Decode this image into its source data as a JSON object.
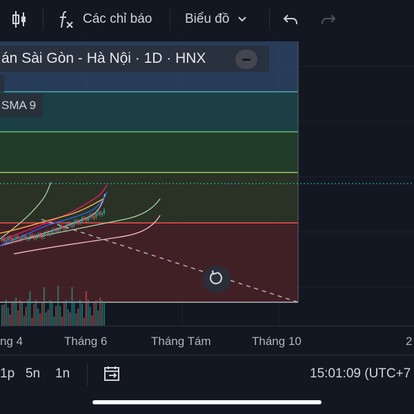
{
  "toolbar": {
    "indicators_label": "Các chỉ báo",
    "chart_type_label": "Biểu đồ"
  },
  "legend": {
    "title": "án Sài Gòn - Hà Nội · 1D · HNX",
    "sma_label": "SMA 9"
  },
  "time_axis": {
    "ticks": [
      "ng 4",
      "Tháng 6",
      "Tháng Tám",
      "Tháng 10",
      "2"
    ]
  },
  "bottom_bar": {
    "ranges": [
      "1p",
      "5n",
      "1n"
    ],
    "clock": "15:01:09 (UTC+7"
  },
  "colors": {
    "background": "#131722",
    "fib_blue": "#2f4a6b",
    "fib_teal": "#1e4a4f",
    "fib_green": "#26432c",
    "fib_olive": "#2f3a25",
    "fib_red": "#4a2226",
    "candle_up": "#26a69a",
    "candle_down": "#ef5350",
    "ma_line": "#2962ff",
    "cloud_green": "#a5d6a7",
    "cloud_pink": "#f8bbd0"
  },
  "icons": {
    "chart_type": "candlestick-icon",
    "indicators": "function-icon",
    "undo": "undo-icon",
    "redo": "redo-icon",
    "reset": "reset-icon",
    "date_range": "calendar-range-icon"
  }
}
